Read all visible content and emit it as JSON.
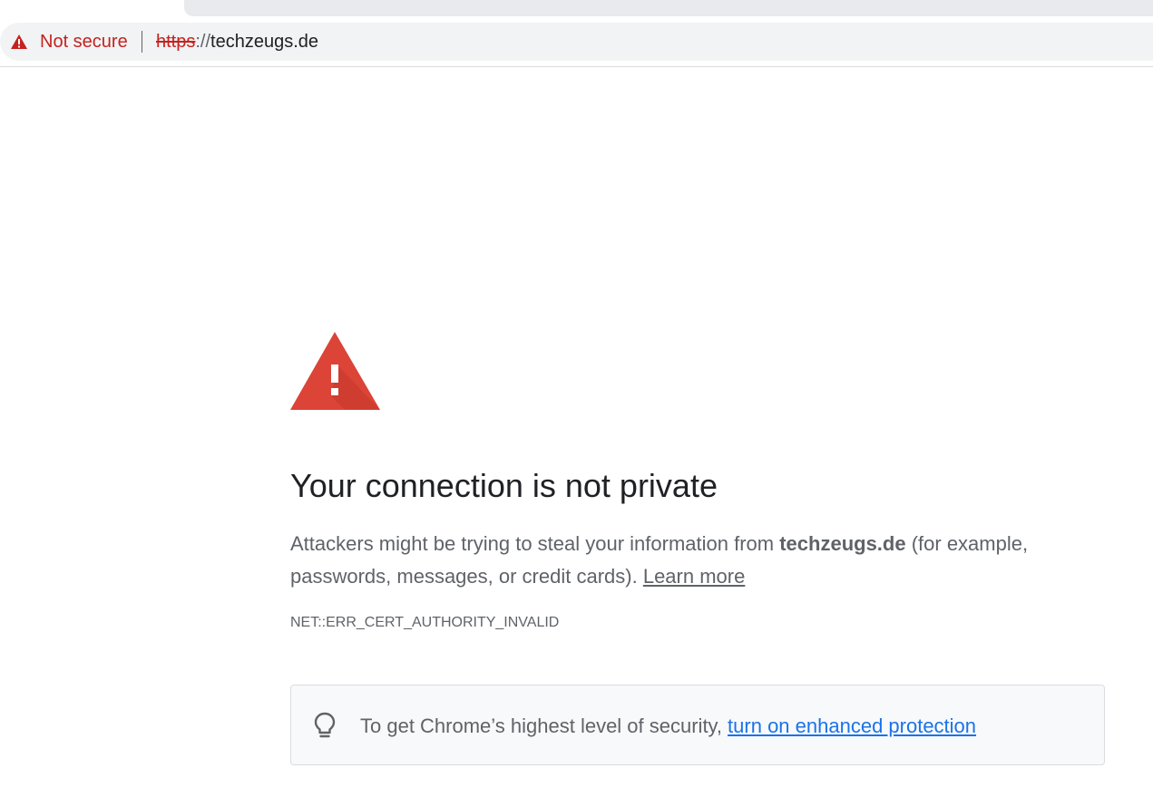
{
  "browser": {
    "security_label": "Not secure",
    "url_scheme": "https",
    "url_separator": "://",
    "url_host": "techzeugs.de",
    "icons": {
      "security": "warning-triangle-icon"
    },
    "colors": {
      "danger": "#c5221f",
      "omnibox_bg": "#f1f3f4"
    }
  },
  "interstitial": {
    "icon": "warning-triangle-icon",
    "heading": "Your connection is not private",
    "explanation_prefix": "Attackers might be trying to steal your information from ",
    "explanation_domain": "techzeugs.de",
    "explanation_suffix": " (for example, passwords, messages, or credit cards).",
    "learn_more": "Learn more",
    "error_code": "NET::ERR_CERT_AUTHORITY_INVALID",
    "enhanced": {
      "icon": "lightbulb-icon",
      "text": "To get Chrome’s highest level of security,",
      "link": "turn on enhanced protection"
    },
    "colors": {
      "warning_red": "#db4437",
      "link_blue": "#1a73e8",
      "text_gray": "#5f6368",
      "heading": "#202124"
    }
  }
}
